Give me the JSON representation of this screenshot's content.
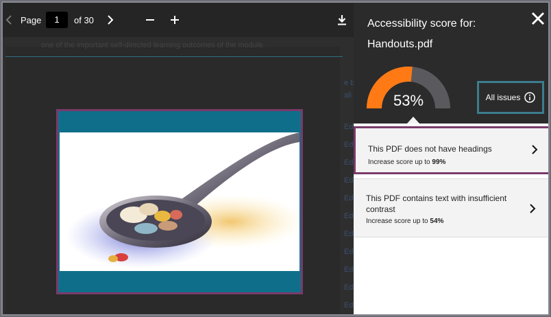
{
  "toolbar": {
    "page_label": "Page",
    "page_value": "1",
    "page_total": "of 30"
  },
  "document": {
    "top_text": "one of the important self-directed learning outcomes of the module.",
    "side_fragments": [
      "e b",
      "ali",
      "",
      "Ed",
      "Ed",
      "Ed",
      "Ed",
      "Ed",
      "Ed",
      "Ed",
      "Ed",
      "Ed",
      "Ed",
      "Ed"
    ]
  },
  "panel": {
    "title": "Accessibility score for:",
    "filename": "Handouts.pdf",
    "score": "53%",
    "score_fraction": 0.53,
    "all_issues_label": "All issues",
    "issues": [
      {
        "title": "This PDF does not have headings",
        "sub_prefix": "Increase score up to ",
        "sub_value": "99%"
      },
      {
        "title": "This PDF contains text with insufficient contrast",
        "sub_prefix": "Increase score up to ",
        "sub_value": "54%"
      }
    ]
  },
  "colors": {
    "gauge_fill": "#ff7a14",
    "gauge_track": "#5a5a5e",
    "highlight_purple": "#7a3a6a",
    "highlight_teal": "#3b7d8e"
  },
  "icons": {
    "prev": "chevron-left-icon",
    "next": "chevron-right-icon",
    "zoom_out": "minus-icon",
    "zoom_in": "plus-icon",
    "download": "download-icon",
    "close": "close-icon",
    "info": "info-icon"
  }
}
